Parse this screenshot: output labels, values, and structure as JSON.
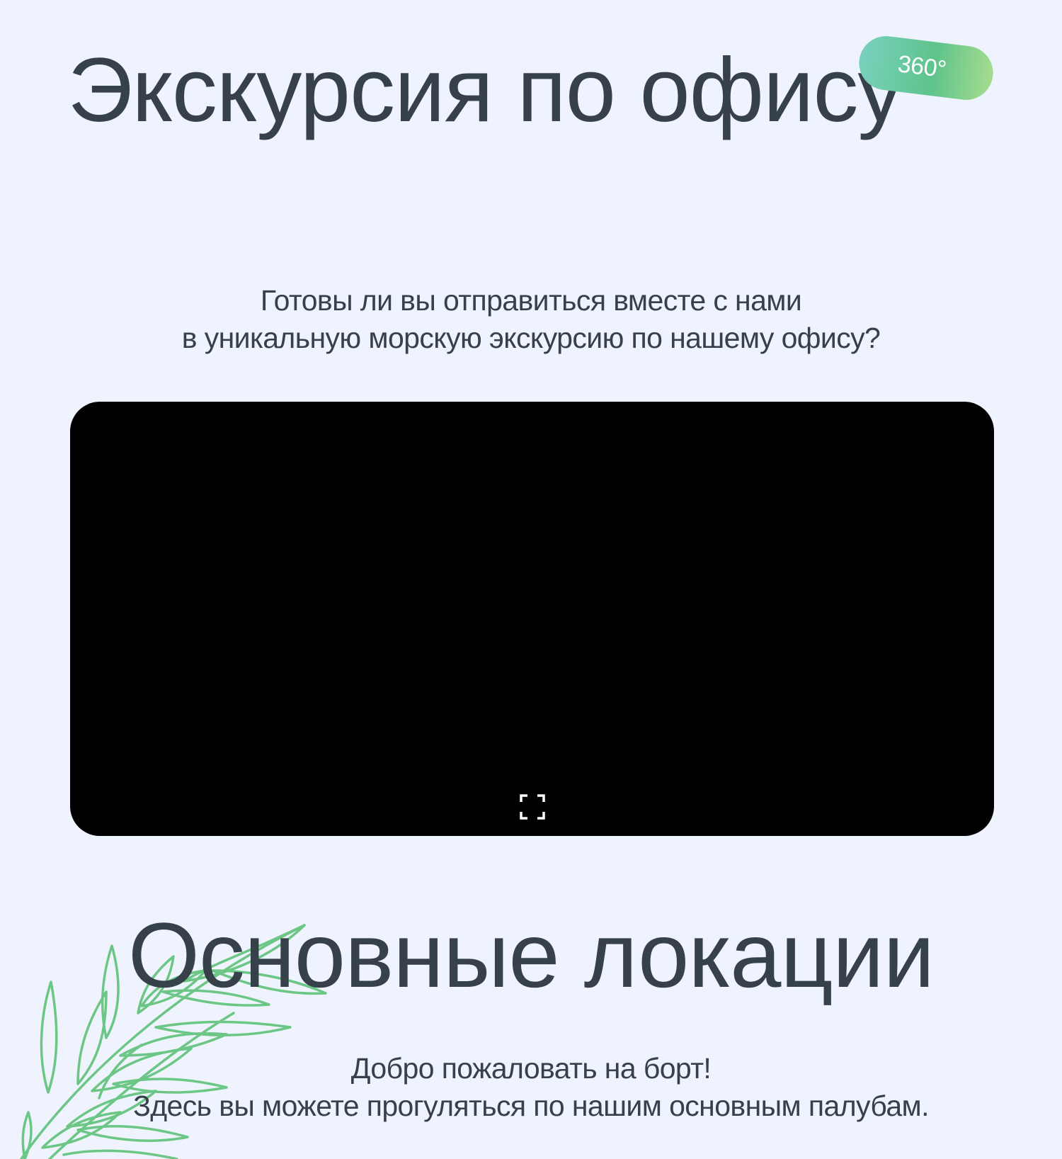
{
  "hero": {
    "title": "Экскурсия по офису",
    "badge": "360°",
    "intro_line1": "Готовы ли вы отправиться вместе с нами",
    "intro_line2": "в уникальную морскую экскурсию по нашему офису?"
  },
  "player": {
    "fullscreen_icon": "fullscreen-icon"
  },
  "locations": {
    "title": "Основные локации",
    "text_line1": "Добро пожаловать на борт!",
    "text_line2": "Здесь вы можете прогуляться по нашим основным палубам."
  },
  "colors": {
    "background": "#eff3fd",
    "text": "#37414a",
    "accent_green": "#5ec38c",
    "leaf_stroke": "#6cc685",
    "player_background": "#000000"
  }
}
